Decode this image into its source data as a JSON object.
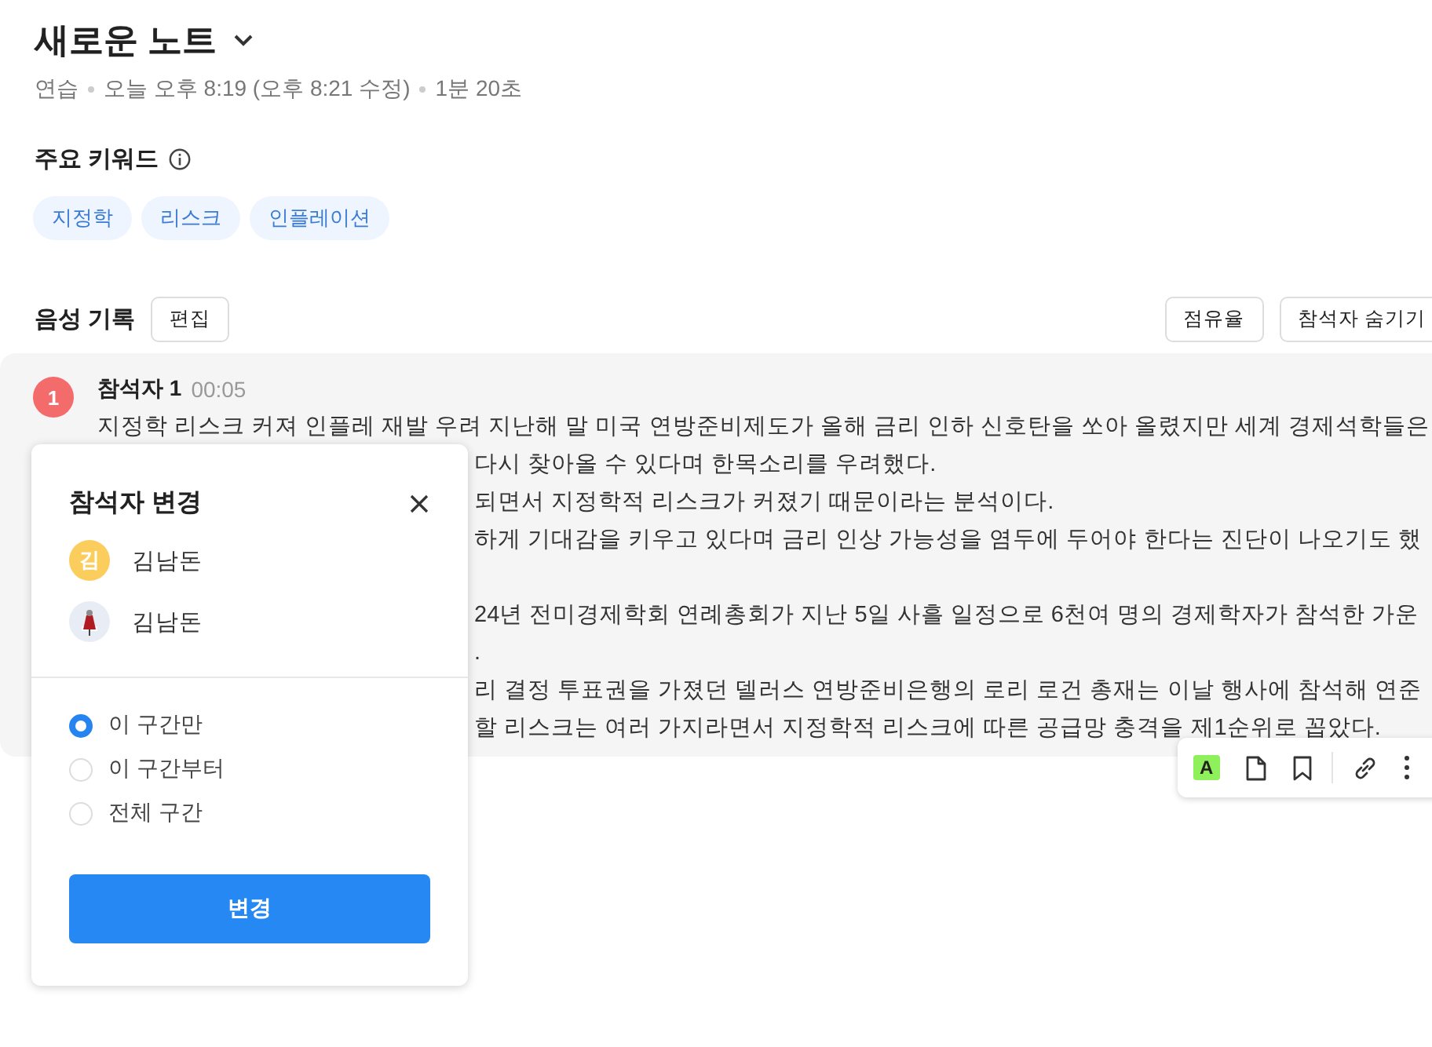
{
  "title": "새로운 노트",
  "meta": [
    "연습",
    "오늘 오후 8:19 (오후 8:21 수정)",
    "1분 20초"
  ],
  "keywords": {
    "heading": "주요 키워드",
    "tags": [
      "지정학",
      "리스크",
      "인플레이션"
    ]
  },
  "transcript": {
    "heading": "음성 기록",
    "edit_button": "편집",
    "actions": [
      "점유율",
      "참석자 숨기기"
    ],
    "segment": {
      "badge": "1",
      "speaker": "참석자 1",
      "time": "00:05",
      "first_line": "지정학 리스크 커져 인플레 재발 우려 지난해 말 미국 연방준비제도가 올해 금리 인하 신호탄을 쏘아 올렸지만 세계 경제석학들은",
      "paragraphs": [
        [
          "다시 찾아올 수 있다며 한목소리를 우려했다.",
          "되면서 지정학적 리스크가 커졌기 때문이라는 분석이다.",
          "하게 기대감을 키우고 있다며 금리 인상 가능성을 염두에 두어야 한다는 진단이 나오기도 했"
        ],
        [
          "24년 전미경제학회 연례총회가 지난 5일 사흘 일정으로 6천여 명의 경제학자가 참석한 가운",
          ".",
          "리 결정 투표권을 가졌던 델러스 연방준비은행의 로리 로건 총재는 이날 행사에 참석해 연준",
          "할 리스크는 여러 가지라면서 지정학적 리스크에 따른 공급망 충격을 제1순위로 꼽았다."
        ]
      ]
    }
  },
  "toolbar": [
    {
      "kind": "highlight",
      "label": "A"
    },
    {
      "kind": "note"
    },
    {
      "kind": "bookmark"
    },
    {
      "kind": "link"
    },
    {
      "kind": "more"
    }
  ],
  "dialog": {
    "title": "참석자 변경",
    "people": [
      {
        "name": "김남돈",
        "kind": "initial",
        "initial": "김"
      },
      {
        "name": "김남돈",
        "kind": "picture"
      }
    ],
    "scope": [
      {
        "label": "이 구간만",
        "selected": true
      },
      {
        "label": "이 구간부터",
        "selected": false
      },
      {
        "label": "전체 구간",
        "selected": false
      }
    ],
    "confirm": "변경"
  }
}
